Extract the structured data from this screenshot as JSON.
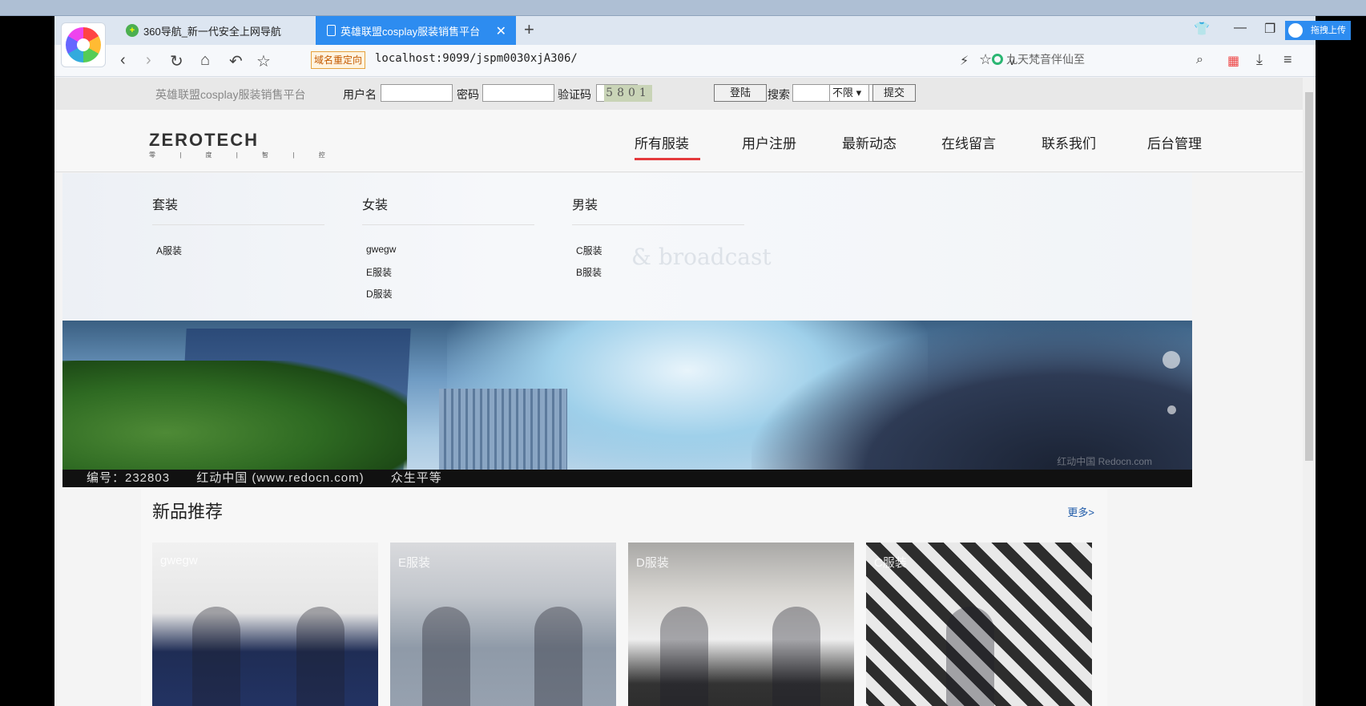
{
  "browser": {
    "tabs": [
      {
        "title": "360导航_新一代安全上网导航",
        "active": false
      },
      {
        "title": "英雄联盟cosplay服装销售平台",
        "active": true
      }
    ],
    "redirect_badge": "域名重定向",
    "url": "localhost:9099/jspm0030xjA306/",
    "search_placeholder": "九天梵音伴仙至",
    "upload_label": "拖拽上传"
  },
  "topbar": {
    "site_name": "英雄联盟cosplay服装销售平台",
    "username_label": "用户名",
    "password_label": "密码",
    "captcha_label": "验证码",
    "captcha_code": "5801",
    "login_button": "登陆",
    "search_label": "搜索",
    "search_scope": "不限",
    "submit_button": "提交"
  },
  "header": {
    "brand": "ZEROTECH",
    "brand_sub": "零 | 度 | 智 | 控",
    "nav": [
      {
        "label": "所有服装",
        "active": true
      },
      {
        "label": "用户注册",
        "active": false
      },
      {
        "label": "最新动态",
        "active": false
      },
      {
        "label": "在线留言",
        "active": false
      },
      {
        "label": "联系我们",
        "active": false
      },
      {
        "label": "后台管理",
        "active": false
      }
    ]
  },
  "dropdown": {
    "columns": [
      {
        "title": "套装",
        "items": [
          "A服装"
        ]
      },
      {
        "title": "女装",
        "items": [
          "gwegw",
          "E服装",
          "D服装"
        ]
      },
      {
        "title": "男装",
        "items": [
          "C服装",
          "B服装"
        ]
      }
    ],
    "background_text": "& broadcast"
  },
  "banner": {
    "caption_number": "编号：232803",
    "caption_site": "红动中国 (www.redocn.com)",
    "caption_slogan": "众生平等",
    "watermark": "红动中国 Redocn.com",
    "slide_count": 2,
    "active_slide": 1
  },
  "new_products": {
    "title": "新品推荐",
    "more": "更多>",
    "items": [
      {
        "name": "gwegw"
      },
      {
        "name": "E服装"
      },
      {
        "name": "D服装"
      },
      {
        "name": "C服装"
      }
    ]
  }
}
